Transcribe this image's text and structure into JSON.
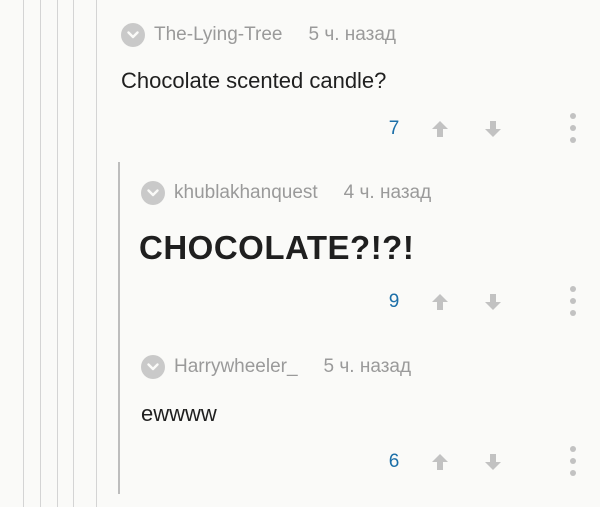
{
  "comments": [
    {
      "username": "The-Lying-Tree",
      "time": "5 ч. назад",
      "text": "Chocolate scented candle?",
      "score": "7"
    },
    {
      "username": "khublakhanquest",
      "time": "4 ч. назад",
      "text": "CHOCOLATE?!?!",
      "score": "9"
    },
    {
      "username": "Harrywheeler_",
      "time": "5 ч. назад",
      "text": "ewwww",
      "score": "6"
    }
  ],
  "colors": {
    "background": "#fafaf8",
    "username": "#9a9a9a",
    "score": "#1c6fa8",
    "icon": "#c2c2c2",
    "text": "#1f1f1f"
  },
  "icons": {
    "collapse": "chevron-down-icon",
    "upvote": "arrow-up-icon",
    "downvote": "arrow-down-icon",
    "more": "more-vertical-icon"
  }
}
